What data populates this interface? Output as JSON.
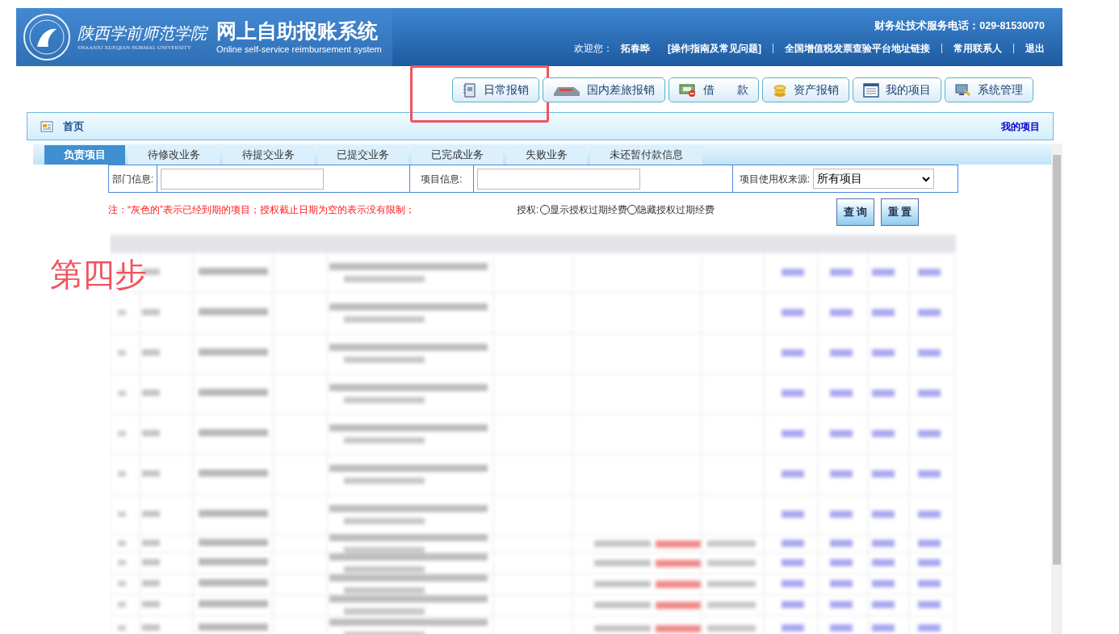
{
  "header": {
    "school_name": "陕西学前师范学院",
    "school_name_en": "SHAANXI XUEQIAN NORMAL UNIVERSITY",
    "system_title": "网上自助报账系统",
    "system_subtitle": "Online self-service reimbursement system",
    "hotline": "财务处技术服务电话：029-81530070",
    "welcome_label": "欢迎您：",
    "user": "拓春晔",
    "links": [
      "[操作指南及常见问题]",
      "全国增值税发票查验平台地址链接",
      "常用联系人",
      "退出"
    ]
  },
  "nav_buttons": [
    {
      "kind": "notebook",
      "label": "日常报销",
      "highlighted": true
    },
    {
      "kind": "train",
      "label": "国内差旅报销",
      "highlighted": false
    },
    {
      "kind": "cash",
      "label": "借　　款",
      "highlighted": false
    },
    {
      "kind": "coins",
      "label": "资产报销",
      "highlighted": false
    },
    {
      "kind": "list",
      "label": "我的项目",
      "highlighted": false
    },
    {
      "kind": "computer",
      "label": "系统管理",
      "highlighted": false
    }
  ],
  "breadcrumb": {
    "label": "首页",
    "right_link": "我的项目"
  },
  "tabs": [
    {
      "label": "负责项目",
      "selected": true
    },
    {
      "label": "待修改业务",
      "selected": false
    },
    {
      "label": "待提交业务",
      "selected": false
    },
    {
      "label": "已提交业务",
      "selected": false
    },
    {
      "label": "已完成业务",
      "selected": false
    },
    {
      "label": "失败业务",
      "selected": false
    },
    {
      "label": "未还暂付款信息",
      "selected": false
    }
  ],
  "filters": {
    "department_label": "部门信息:",
    "project_label": "项目信息:",
    "source_label": "项目使用权来源:",
    "source_value": "所有项目"
  },
  "note": "注：“灰色的”表示已经到期的项目；授权截止日期为空的表示没有限制；",
  "authorization": {
    "label": "授权:",
    "options": [
      {
        "label": "显示授权过期经费",
        "checked": false
      },
      {
        "label": "隐藏授权过期经费",
        "checked": false
      }
    ]
  },
  "actions": [
    "查 询",
    "重 置"
  ],
  "step_annotation": "第四步"
}
